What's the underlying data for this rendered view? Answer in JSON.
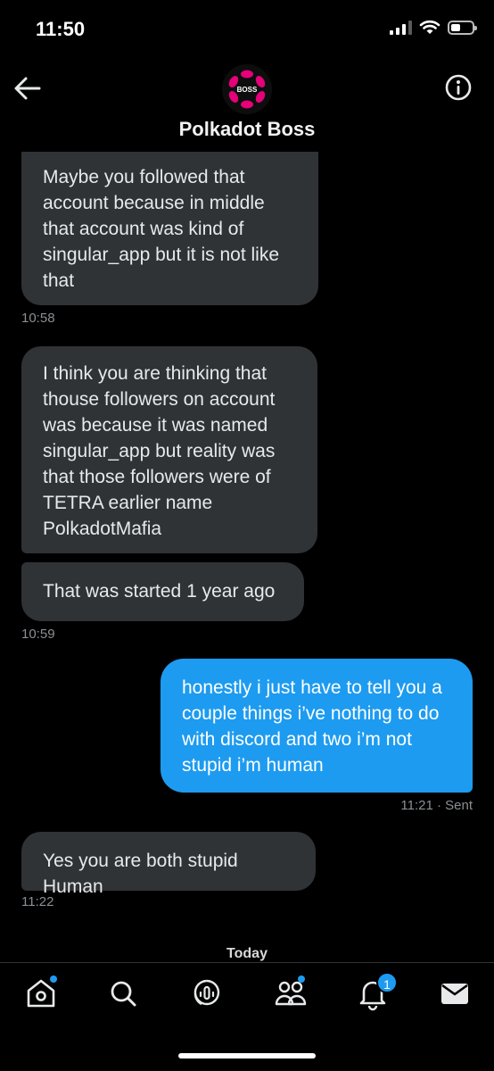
{
  "status_bar": {
    "time": "11:50"
  },
  "header": {
    "contact_name": "Polkadot Boss",
    "avatar_text": "BOSS"
  },
  "messages": [
    {
      "direction": "in",
      "text": "Maybe you followed that account because in middle that account was kind of singular_app but it is not like that"
    },
    {
      "direction": "in",
      "time": "10:58"
    },
    {
      "direction": "in",
      "text": "I think you are thinking that thouse followers on account was because it was named singular_app but reality was that those followers were of TETRA earlier name PolkadotMafia"
    },
    {
      "direction": "in",
      "text": "That was started 1 year ago",
      "time": "10:59"
    },
    {
      "direction": "out",
      "text": "honestly i just have to tell you a couple things i’ve nothing to do with discord and two i’m not stupid i’m human",
      "time": "11:21 · Sent"
    },
    {
      "direction": "in",
      "text": "Yes you are both stupid Human",
      "time": "11:22"
    }
  ],
  "divider": {
    "label": "Today"
  },
  "bottom_nav": {
    "notifications_badge": "1",
    "items": [
      "home-icon",
      "search-icon",
      "spaces-icon",
      "communities-icon",
      "notifications-icon",
      "messages-icon"
    ]
  },
  "colors": {
    "accent": "#1d9bf0",
    "incoming_bubble": "#2f3336",
    "background": "#000000"
  }
}
